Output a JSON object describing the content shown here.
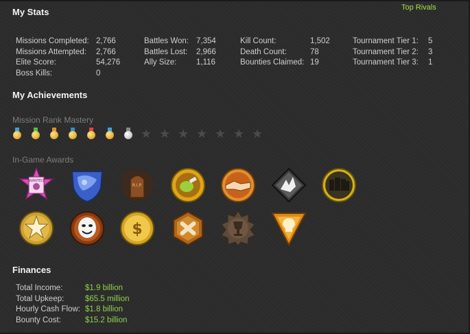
{
  "header": {
    "title": "My Stats",
    "top_rivals_link": "Top Rivals"
  },
  "stats": {
    "col1": [
      {
        "label": "Missions Completed:",
        "value": "2,766"
      },
      {
        "label": "Missions Attempted:",
        "value": "2,766"
      },
      {
        "label": "Elite Score:",
        "value": "54,276"
      },
      {
        "label": "Boss Kills:",
        "value": "0"
      }
    ],
    "col2": [
      {
        "label": "Battles Won:",
        "value": "7,354"
      },
      {
        "label": "Battles Lost:",
        "value": "2,966"
      },
      {
        "label": "Ally Size:",
        "value": "1,116"
      }
    ],
    "col3": [
      {
        "label": "Kill Count:",
        "value": "1,502"
      },
      {
        "label": "Death Count:",
        "value": "78"
      },
      {
        "label": "Bounties Claimed:",
        "value": "19"
      }
    ],
    "col4": [
      {
        "label": "Tournament Tier 1:",
        "value": "5"
      },
      {
        "label": "Tournament Tier 2:",
        "value": "3"
      },
      {
        "label": "Tournament Tier 3:",
        "value": "1"
      }
    ]
  },
  "achievements": {
    "title": "My Achievements",
    "mission_rank_label": "Mission Rank Mastery",
    "medals": [
      {
        "ribbon": "#3aa3e0",
        "disc": "#e6b43a",
        "earned": true
      },
      {
        "ribbon": "#49c24a",
        "disc": "#e6b43a",
        "earned": true
      },
      {
        "ribbon": "#e68a2e",
        "disc": "#e6b43a",
        "earned": true
      },
      {
        "ribbon": "#2f8fd0",
        "disc": "#e6b43a",
        "earned": true
      },
      {
        "ribbon": "#e0453a",
        "disc": "#e6b43a",
        "earned": true
      },
      {
        "ribbon": "#3aa3e0",
        "disc": "#e6b43a",
        "earned": true
      },
      {
        "ribbon": "#9a9a9a",
        "disc": "#d0d0d0",
        "earned": true
      }
    ],
    "empty_stars": 7,
    "awards_label": "In-Game Awards",
    "awards": [
      {
        "icon": "wanted-poster-icon",
        "label": "WANTED"
      },
      {
        "icon": "blue-crest-icon"
      },
      {
        "icon": "tombstone-icon",
        "label": "R.I.P."
      },
      {
        "icon": "grenade-icon"
      },
      {
        "icon": "handshake-icon"
      },
      {
        "icon": "shattered-shield-icon"
      },
      {
        "icon": "crowd-icon"
      },
      {
        "icon": "star-wing-icon"
      },
      {
        "icon": "comedy-mask-icon"
      },
      {
        "icon": "money-bag-icon"
      },
      {
        "icon": "bones-icon"
      },
      {
        "icon": "trophy-icon"
      },
      {
        "icon": "skull-triangle-icon"
      }
    ]
  },
  "finances": {
    "title": "Finances",
    "rows": [
      {
        "label": "Total Income:",
        "value": "$1.9 billion"
      },
      {
        "label": "Total Upkeep:",
        "value": "$65.5 million"
      },
      {
        "label": "Hourly Cash Flow:",
        "value": "$1.8 billion"
      },
      {
        "label": "Bounty Cost:",
        "value": "$15.2 billion"
      }
    ]
  },
  "colors": {
    "accent_green": "#8fd24a",
    "link_green": "#a6e04a",
    "background": "#2b2b2b"
  }
}
